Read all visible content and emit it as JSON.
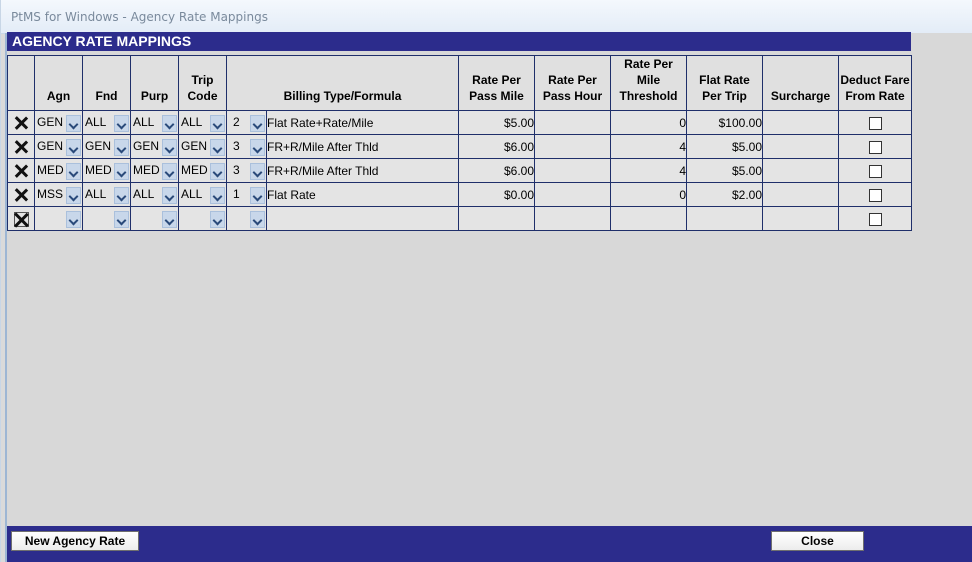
{
  "window": {
    "title": "PtMS for Windows - Agency Rate Mappings"
  },
  "header": {
    "title": "AGENCY RATE MAPPINGS"
  },
  "columns": {
    "agn": "Agn",
    "fnd": "Fnd",
    "purp": "Purp",
    "trip_code": "Trip Code",
    "billing": "Billing Type/Formula",
    "rate_pass_mile": "Rate Per Pass Mile",
    "rate_pass_hour": "Rate Per Pass Hour",
    "rate_mile_threshold": "Rate Per Mile Threshold",
    "flat_rate_trip": "Flat Rate Per Trip",
    "surcharge": "Surcharge",
    "deduct_fare": "Deduct Fare From Rate"
  },
  "rows": [
    {
      "agn": "GEN",
      "fnd": "ALL",
      "purp": "ALL",
      "trip": "ALL",
      "billing_code": "2",
      "billing": "Flat Rate+Rate/Mile",
      "rate_pass_mile": "$5.00",
      "rate_pass_hour": "",
      "threshold": "0",
      "flat_rate": "$100.00",
      "surcharge": ""
    },
    {
      "agn": "GEN",
      "fnd": "GEN",
      "purp": "GEN",
      "trip": "GEN",
      "billing_code": "3",
      "billing": "FR+R/Mile After Thld",
      "rate_pass_mile": "$6.00",
      "rate_pass_hour": "",
      "threshold": "4",
      "flat_rate": "$5.00",
      "surcharge": ""
    },
    {
      "agn": "MED",
      "fnd": "MED",
      "purp": "MED",
      "trip": "MED",
      "billing_code": "3",
      "billing": "FR+R/Mile After Thld",
      "rate_pass_mile": "$6.00",
      "rate_pass_hour": "",
      "threshold": "4",
      "flat_rate": "$5.00",
      "surcharge": ""
    },
    {
      "agn": "MSS",
      "fnd": "ALL",
      "purp": "ALL",
      "trip": "ALL",
      "billing_code": "1",
      "billing": "Flat Rate",
      "rate_pass_mile": "$0.00",
      "rate_pass_hour": "",
      "threshold": "0",
      "flat_rate": "$2.00",
      "surcharge": ""
    },
    {
      "agn": "",
      "fnd": "",
      "purp": "",
      "trip": "",
      "billing_code": "",
      "billing": "",
      "rate_pass_mile": "",
      "rate_pass_hour": "",
      "threshold": "",
      "flat_rate": "",
      "surcharge": ""
    }
  ],
  "buttons": {
    "new_agency_rate": "New Agency Rate",
    "close": "Close"
  },
  "colors": {
    "header_bar": "#2c2c8c",
    "grid_line": "#1f2f6a",
    "dropdown": "#c8d7ea"
  }
}
